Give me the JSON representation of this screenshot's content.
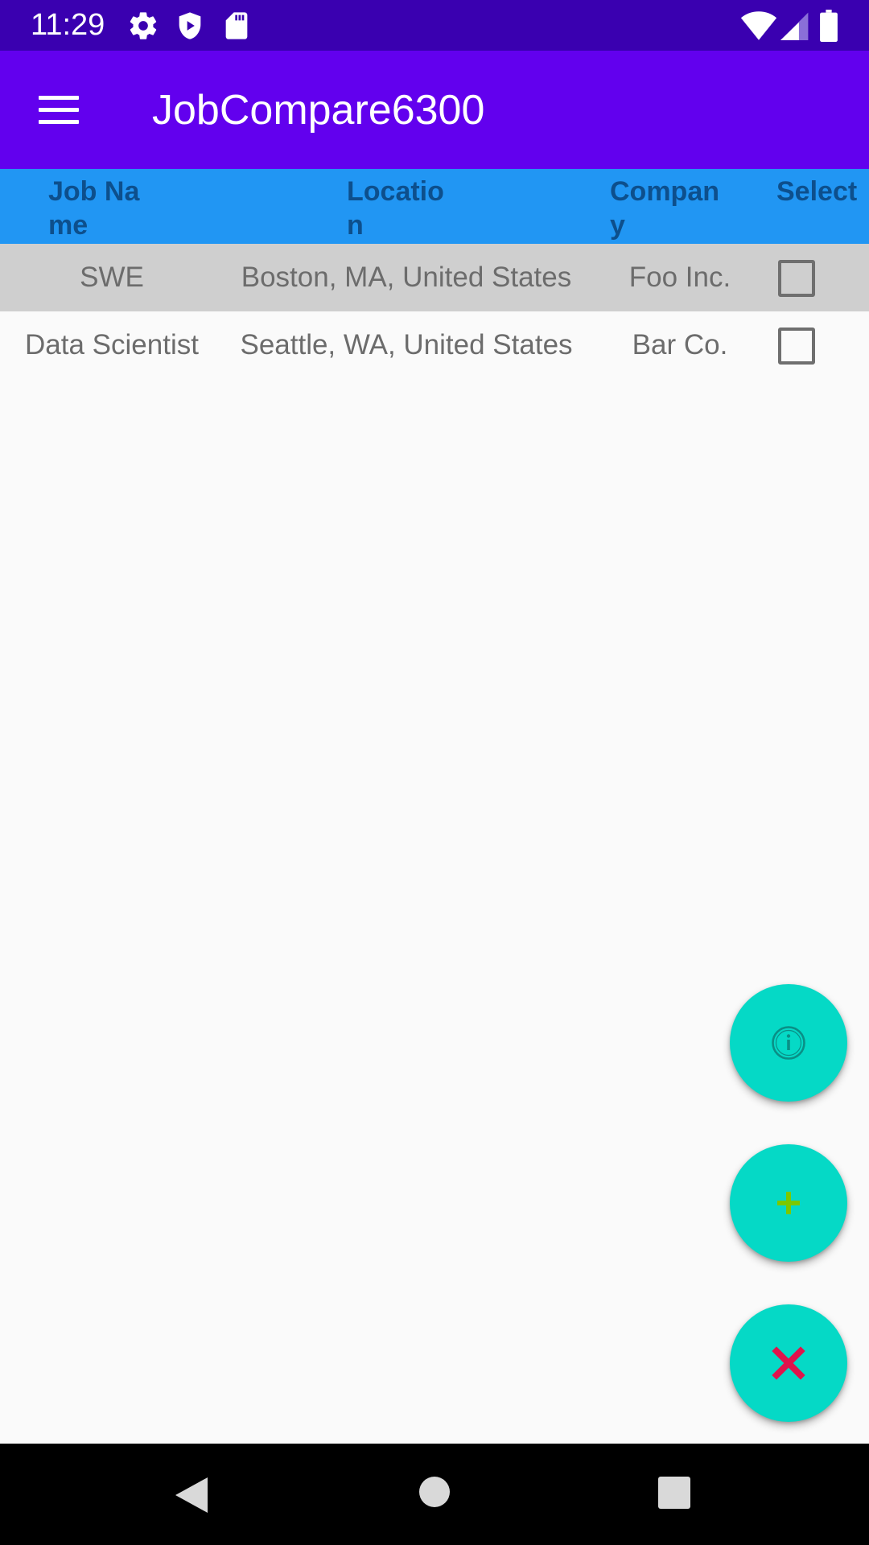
{
  "status_bar": {
    "time": "11:29",
    "left_icons": [
      "settings-icon",
      "shield-icon",
      "sd-card-icon"
    ],
    "right_icons": [
      "wifi-icon",
      "signal-icon",
      "battery-icon"
    ],
    "background": "#3a00b0"
  },
  "app_bar": {
    "title": "JobCompare6300",
    "menu_icon": "hamburger-menu-icon",
    "background": "#6200ee"
  },
  "table": {
    "header_background": "#2196f3",
    "header_text_color": "#0d4f8c",
    "columns": [
      "Job Name",
      "Location",
      "Company",
      "Select"
    ],
    "rows": [
      {
        "job_name": "SWE",
        "location": "Boston, MA, United States",
        "company": "Foo Inc.",
        "selected": false,
        "highlighted": true
      },
      {
        "job_name": "Data Scientist",
        "location": "Seattle, WA, United States",
        "company": "Bar Co.",
        "selected": false,
        "highlighted": false
      }
    ]
  },
  "fabs": [
    {
      "name": "info",
      "icon": "info-icon",
      "icon_color": "#0a8f86"
    },
    {
      "name": "add",
      "icon": "plus-icon",
      "icon_color": "#7cc800"
    },
    {
      "name": "delete",
      "icon": "close-icon",
      "icon_color": "#e0144c"
    }
  ],
  "fab_color": "#05d9c6",
  "nav_bar": {
    "buttons": [
      "back-icon",
      "home-icon",
      "recents-icon"
    ]
  }
}
